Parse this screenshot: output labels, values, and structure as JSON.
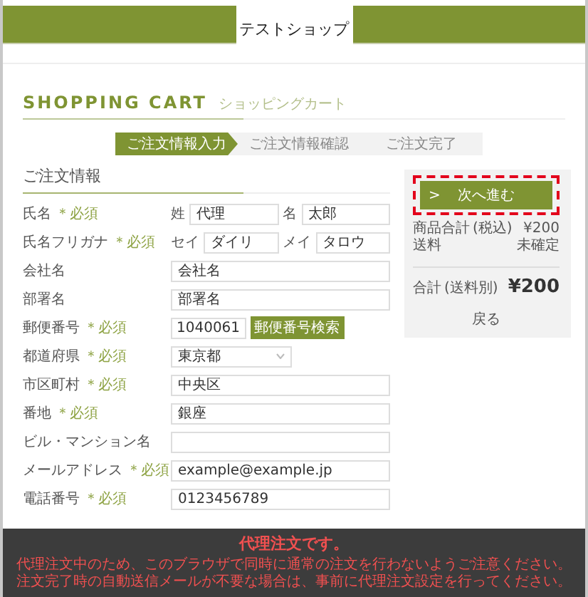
{
  "shop_name": "テストショップ",
  "page_title": "SHOPPING CART",
  "page_subtitle": "ショッピングカート",
  "steps": [
    {
      "label": "ご注文情報入力",
      "selected": true
    },
    {
      "label": "ご注文情報確認",
      "selected": false
    },
    {
      "label": "ご注文完了",
      "selected": false
    }
  ],
  "section_title": "ご注文情報",
  "rows": [
    {
      "kind": "pair",
      "label": "氏名",
      "required_mark": "＊必須",
      "parts": [
        {
          "prefix": "姓",
          "value": "代理"
        },
        {
          "prefix": "名",
          "value": "太郎"
        }
      ]
    },
    {
      "kind": "pair",
      "label": "氏名フリガナ",
      "required_mark": "＊必須",
      "parts": [
        {
          "prefix": "セイ",
          "value": "ダイリ"
        },
        {
          "prefix": "メイ",
          "value": "タロウ"
        }
      ]
    },
    {
      "kind": "text",
      "label": "会社名",
      "value": "会社名"
    },
    {
      "kind": "text",
      "label": "部署名",
      "value": "部署名"
    },
    {
      "kind": "postal",
      "label": "郵便番号",
      "required_mark": "＊必須",
      "value": "1040061",
      "button": "郵便番号検索"
    },
    {
      "kind": "select",
      "label": "都道府県",
      "required_mark": "＊必須",
      "value": "東京都"
    },
    {
      "kind": "text",
      "label": "市区町村",
      "required_mark": "＊必須",
      "value": "中央区"
    },
    {
      "kind": "text",
      "label": "番地",
      "required_mark": "＊必須",
      "value": "銀座"
    },
    {
      "kind": "text",
      "label": "ビル・マンション名"
    },
    {
      "kind": "text",
      "label": "メールアドレス",
      "required_mark": "＊必須",
      "value": "example@example.jp"
    },
    {
      "kind": "text",
      "label": "電話番号",
      "required_mark": "＊必須",
      "value": "0123456789"
    }
  ],
  "summary": {
    "next_button": "次へ進む",
    "next_button_icon": ">",
    "lines": [
      {
        "label": "商品合計",
        "note": "(税込)",
        "value": "¥200"
      },
      {
        "label": "送料",
        "value": "未確定"
      }
    ],
    "total": {
      "label": "合計",
      "note": "(送料別)",
      "value": "¥200"
    },
    "back_link": "戻る"
  },
  "notice": {
    "title": "代理注文です。",
    "lines": [
      "代理注文中のため、このブラウザで同時に通常の注文を行わないようご注意ください。",
      "注文完了時の自動送信メールが不要な場合は、事前に代理注文設定を行ってください。"
    ]
  }
}
